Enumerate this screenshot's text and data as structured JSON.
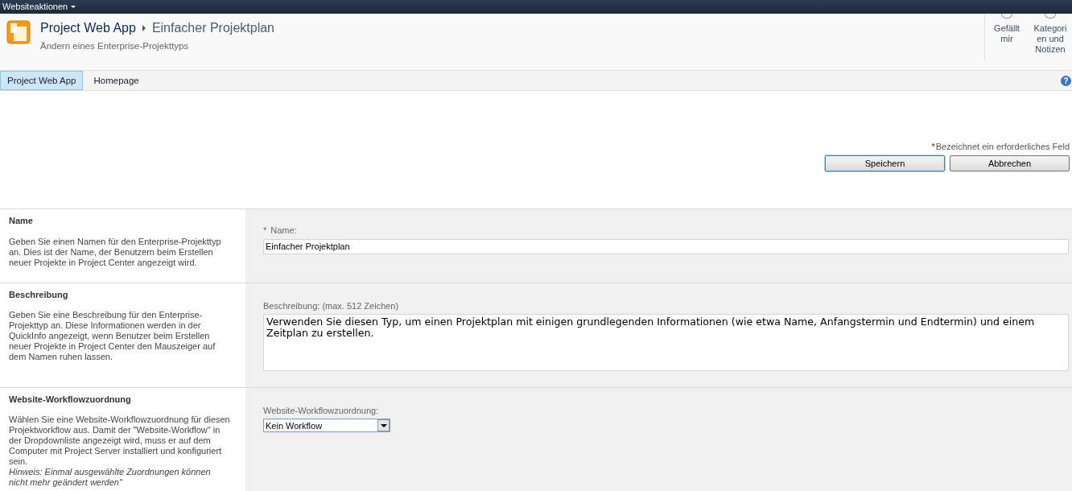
{
  "top_bar": {
    "site_actions": "Websiteaktionen"
  },
  "header": {
    "site_title": "Project Web App",
    "page_title": "Einfacher Projektplan",
    "subtitle": "Ändern eines Enterprise-Projekttyps",
    "actions": [
      {
        "label": "Gefällt mir"
      },
      {
        "label": "Kategori en und Notizen"
      }
    ]
  },
  "nav": {
    "tabs": [
      {
        "label": "Project Web App",
        "selected": true
      },
      {
        "label": "Homepage",
        "selected": false
      }
    ],
    "help": "?"
  },
  "form": {
    "required_mark": "*",
    "required_note": "Bezeichnet ein erforderliches Feld",
    "buttons": [
      {
        "label": "Speichern",
        "selected": true
      },
      {
        "label": "Abbrechen",
        "selected": false
      }
    ],
    "sections": [
      {
        "kind": "text",
        "title": "Name",
        "description": "Geben Sie einen Namen für den Enterprise-Projekttyp an. Dies ist der Name, der Benutzern beim Erstellen neuer Projekte in Project Center angezeigt wird.",
        "label": "Name:",
        "required_mark": "*",
        "value": "Einfacher Projektplan"
      },
      {
        "kind": "textarea",
        "title": "Beschreibung",
        "description": "Geben Sie eine Beschreibung für den Enterprise-Projekttyp an. Diese Informationen werden in der QuickInfo angezeigt, wenn Benutzer beim Erstellen neuer Projekte in Project Center den Mauszeiger auf dem Namen ruhen lassen.",
        "label": "Beschreibung: (max. 512 Zeichen)",
        "value": "Verwenden Sie diesen Typ, um einen Projektplan mit einigen grundlegenden Informationen (wie etwa Name, Anfangstermin und Endtermin) und einem Zeitplan zu erstellen."
      },
      {
        "kind": "select",
        "title": "Website-Workflowzuordnung",
        "description": "Wählen Sie eine Website-Workflowzuordnung für diesen Projektworkflow aus. Damit der \"Website-Workflow\" in der Dropdownliste angezeigt wird, muss er auf dem Computer mit Project Server installiert und konfiguriert sein.",
        "hint": "Hinweis: Einmal ausgewählte Zuordnungen können nicht mehr geändert werden\"",
        "label": "Website-Workflowzuordnung:",
        "value": "Kein Workflow"
      }
    ]
  }
}
